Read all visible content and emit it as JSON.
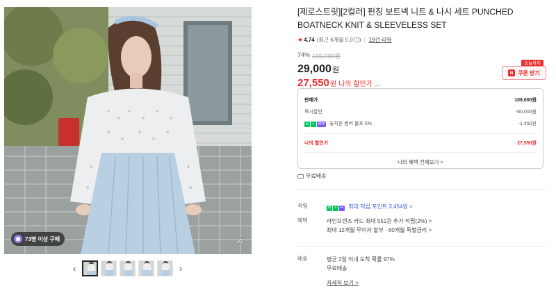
{
  "gallery": {
    "buy_badge": "73명 이상 구매",
    "counter": "1/7",
    "thumbnail_count": 5
  },
  "product": {
    "title": "[제로스트릿][2컬러] 펀칭 보트넥 니트 & 나시 세트 PUNCHED BOATNECK KNIT & SLEEVELESS SET",
    "rating": "4.74",
    "rating_detail": "(최근 6개월 5.0",
    "reviews": "19건 리뷰",
    "discount_pct": "74%",
    "original_price": "109,000원",
    "price": "29,000",
    "price_unit": "원",
    "my_price": "27,550",
    "my_price_unit": "원",
    "my_price_label": "나의 할인가"
  },
  "coupon": {
    "badge": "오늘까지",
    "label": "쿠폰 받기",
    "logo": "N"
  },
  "benefit_box": {
    "sale_price_label": "판매가",
    "sale_price_value": "109,000원",
    "instant_label": "즉시할인",
    "instant_value": "-80,000원",
    "chip_n": "N",
    "chip_plus": "+",
    "chip_app": "APP",
    "app_label": "놓치운 썸머 블프 5%",
    "app_value": "-1,450원",
    "my_price_label": "나의 할인가",
    "my_price_value": "27,550원",
    "all_benefits": "나의 혜택 전체보기 >"
  },
  "shipping_free": "무료배송",
  "earn": {
    "label": "적립",
    "text": "최대 적립 포인트 3,454원 >"
  },
  "benefit": {
    "label": "혜택",
    "line1": "라인프렌즈 카드 최대 551원 추가 적립(2%) >",
    "line2": "최대 12개월 무이자 할부 · 60개월 특별금리 >"
  },
  "delivery": {
    "label": "배송",
    "line1": "평균 2일 이내 도착 확률 97%",
    "line2": "무료배송",
    "more": "자세히 보기 >"
  }
}
